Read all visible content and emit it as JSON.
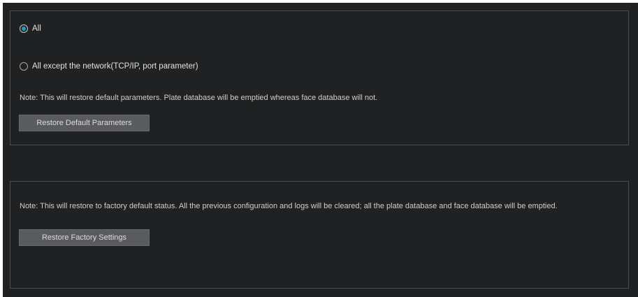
{
  "restore_defaults": {
    "options": [
      {
        "label": "All",
        "selected": true
      },
      {
        "label": "All except the network(TCP/IP, port parameter)",
        "selected": false
      }
    ],
    "note": "Note: This will restore default parameters. Plate database will be emptied whereas face database will not.",
    "button_label": "Restore Default Parameters"
  },
  "factory_reset": {
    "note": "Note: This will restore to factory default status. All the previous configuration and logs will be cleared; all the plate database and face database will be emptied.",
    "button_label": "Restore Factory Settings"
  },
  "colors": {
    "background": "#202122",
    "panel_border": "#4b4c4e",
    "button_bg": "#595b5e",
    "radio_accent": "#1aa0c8"
  }
}
